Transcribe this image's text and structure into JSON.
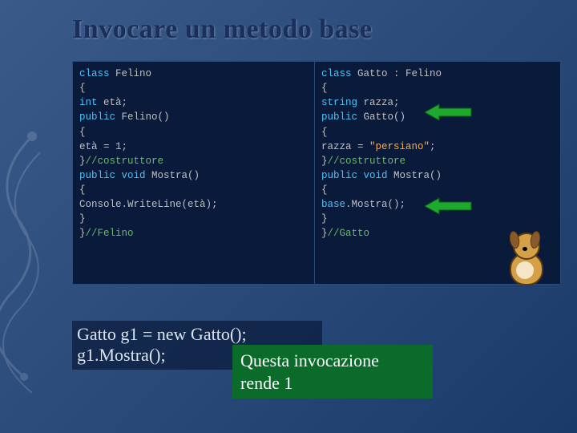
{
  "title": "Invocare un metodo base",
  "code_left": {
    "lines": [
      {
        "pre": "",
        "kw": "class",
        "rest": " Felino"
      },
      {
        "pre": "{",
        "kw": "",
        "rest": ""
      },
      {
        "pre": " ",
        "kw": "int",
        "rest": " età;"
      },
      {
        "pre": " ",
        "kw": "public",
        "rest": " Felino()"
      },
      {
        "pre": " {",
        "kw": "",
        "rest": ""
      },
      {
        "pre": "   età = 1;",
        "kw": "",
        "rest": ""
      },
      {
        "pre": " }",
        "kw": "",
        "rest": "",
        "cm": "//costruttore"
      },
      {
        "pre": " ",
        "kw": "public void",
        "rest": " Mostra()"
      },
      {
        "pre": " {",
        "kw": "",
        "rest": ""
      },
      {
        "pre": "  Console.WriteLine(età);",
        "kw": "",
        "rest": ""
      },
      {
        "pre": " }",
        "kw": "",
        "rest": ""
      },
      {
        "pre": "}",
        "kw": "",
        "rest": "",
        "cm": "//Felino"
      }
    ]
  },
  "code_right": {
    "lines": [
      {
        "pre": "",
        "kw": "class",
        "rest": " Gatto : Felino"
      },
      {
        "pre": "{",
        "kw": "",
        "rest": ""
      },
      {
        "pre": " ",
        "kw": "string",
        "rest": " razza;"
      },
      {
        "pre": " ",
        "kw": "public",
        "rest": " Gatto()"
      },
      {
        "pre": " {",
        "kw": "",
        "rest": ""
      },
      {
        "pre": "   razza = ",
        "kw": "",
        "rest": "",
        "str": "\"persiano\"",
        "tail": ";"
      },
      {
        "pre": " }",
        "kw": "",
        "rest": "",
        "cm": "//costruttore"
      },
      {
        "pre": " ",
        "kw": "public void",
        "rest": " Mostra()"
      },
      {
        "pre": " {",
        "kw": "",
        "rest": ""
      },
      {
        "pre": "  ",
        "kw": "base",
        "rest": ".Mostra();"
      },
      {
        "pre": " }",
        "kw": "",
        "rest": ""
      },
      {
        "pre": "}",
        "kw": "",
        "rest": "",
        "cm": "//Gatto"
      }
    ]
  },
  "instance": {
    "line1": "Gatto g1 = new Gatto();",
    "line2": "g1.Mostra();"
  },
  "callout": {
    "line1": "Questa invocazione",
    "line2": "rende 1"
  },
  "arrows": {
    "a1_desc": "arrow to Gatto()",
    "a2_desc": "arrow to base.Mostra()"
  }
}
